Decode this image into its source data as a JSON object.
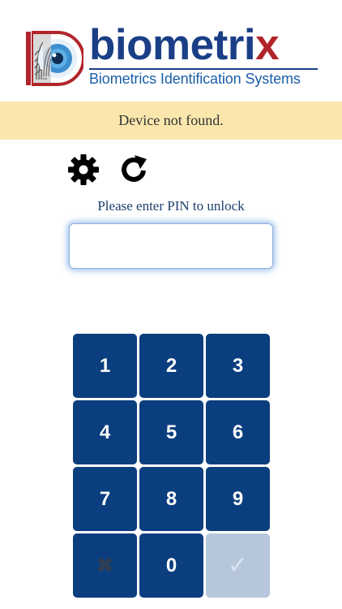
{
  "brand": {
    "name_main": "biometri",
    "name_x": "x",
    "tagline": "Biometrics Identification Systems",
    "logo_icon": "fingerprint-eye-logo",
    "colors": {
      "primary": "#1b3f86",
      "accent": "#b1252a",
      "tagline": "#1b5ea8"
    }
  },
  "status": {
    "message": "Device not found.",
    "background": "#fbe7ad"
  },
  "tools": {
    "settings_icon": "gear-icon",
    "refresh_icon": "refresh-icon"
  },
  "prompt": "Please enter PIN to unlock",
  "pin": {
    "value": "",
    "placeholder": ""
  },
  "keypad": {
    "keys": [
      "1",
      "2",
      "3",
      "4",
      "5",
      "6",
      "7",
      "8",
      "9"
    ],
    "clear_symbol": "✖",
    "zero": "0",
    "confirm_symbol": "✓",
    "colors": {
      "key": "#0b3e7e",
      "confirm_disabled": "#b6c7dc"
    }
  }
}
